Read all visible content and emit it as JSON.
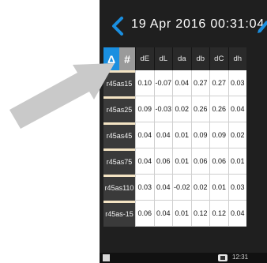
{
  "header": {
    "title": "19 Apr 2016 00:31:04"
  },
  "tabs": {
    "delta_label": "Δ",
    "hash_label": "#"
  },
  "columns": [
    "dE",
    "dL",
    "da",
    "db",
    "dC",
    "dh"
  ],
  "rows": [
    {
      "name": "r45as15",
      "values": [
        "0.10",
        "-0.07",
        "0.04",
        "0.27",
        "0.27",
        "0.03"
      ]
    },
    {
      "name": "r45as25",
      "values": [
        "0.09",
        "-0.03",
        "0.02",
        "0.26",
        "0.26",
        "0.04"
      ]
    },
    {
      "name": "r45as45",
      "values": [
        "0.04",
        "0.04",
        "0.01",
        "0.09",
        "0.09",
        "0.02"
      ]
    },
    {
      "name": "r45as75",
      "values": [
        "0.04",
        "0.06",
        "0.01",
        "0.06",
        "0.06",
        "0.01"
      ]
    },
    {
      "name": "r45as110",
      "values": [
        "0.03",
        "0.04",
        "-0.02",
        "0.02",
        "0.01",
        "0.03"
      ]
    },
    {
      "name": "r45as-15",
      "values": [
        "0.06",
        "0.04",
        "0.01",
        "0.12",
        "0.12",
        "0.04"
      ]
    }
  ],
  "statusbar": {
    "time": "12:31"
  },
  "icons": {
    "back": "back-chevron-icon",
    "edit": "pencil-icon",
    "arrow": "pointer-arrow-icon"
  },
  "colors": {
    "accent": "#1a8fe0",
    "background": "#1f1f1f",
    "arrow": "#c9c9c9"
  }
}
